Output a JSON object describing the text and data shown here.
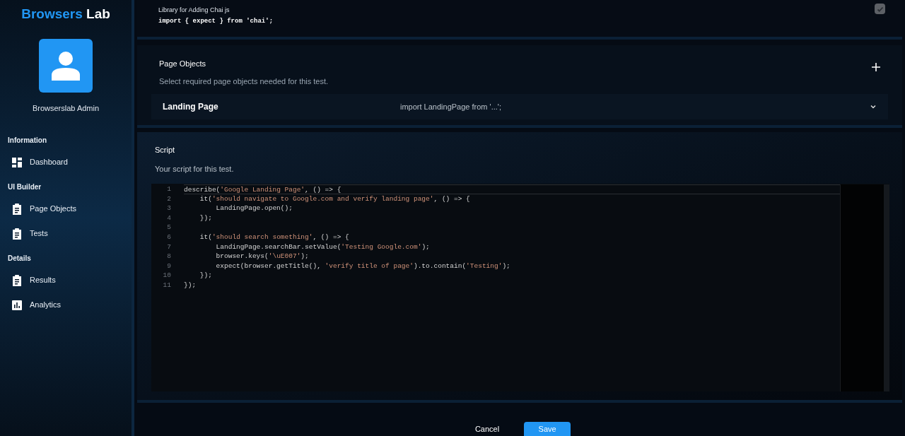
{
  "brand": {
    "first": "Browsers",
    "second": "Lab"
  },
  "user": {
    "name": "Browserslab Admin"
  },
  "sidebar": {
    "sections": [
      {
        "title": "Information",
        "items": [
          {
            "label": "Dashboard",
            "kind": "dashboard"
          }
        ]
      },
      {
        "title": "UI Builder",
        "items": [
          {
            "label": "Page Objects",
            "kind": "clipboard"
          },
          {
            "label": "Tests",
            "kind": "clipboard"
          }
        ]
      },
      {
        "title": "Details",
        "items": [
          {
            "label": "Results",
            "kind": "clipboard"
          },
          {
            "label": "Analytics",
            "kind": "chart"
          }
        ]
      }
    ]
  },
  "library": {
    "description": "Library for Adding Chai js",
    "code": "import { expect } from 'chai';",
    "checked": true,
    "disabled": true
  },
  "page_objects": {
    "title": "Page Objects",
    "subtitle": "Select required page objects needed for this test.",
    "items": [
      {
        "name": "Landing Page",
        "import": "import LandingPage from '...';",
        "expanded": false
      }
    ]
  },
  "script": {
    "title": "Script",
    "subtitle": "Your script for this test.",
    "lines": [
      {
        "number": "1",
        "code": "describe('Google Landing Page', () => {"
      },
      {
        "number": "2",
        "code": "    it('should navigate to Google.com and verify landing page', () => {"
      },
      {
        "number": "3",
        "code": "        LandingPage.open();"
      },
      {
        "number": "4",
        "code": "    });"
      },
      {
        "number": "5"
      },
      {
        "number": "6",
        "code": "    it('should search something', () => {"
      },
      {
        "number": "7",
        "code": "        LandingPage.searchBar.setValue('Testing Google.com');"
      },
      {
        "number": "8",
        "code": "        browser.keys('\\uE007');"
      },
      {
        "number": "9",
        "code": "        expect(browser.getTitle(), 'verify title of page').to.contain('Testing');"
      },
      {
        "number": "10",
        "code": "    });"
      },
      {
        "number": "11",
        "code": "});"
      }
    ]
  },
  "actions": {
    "cancel": "Cancel",
    "save": "Save"
  }
}
